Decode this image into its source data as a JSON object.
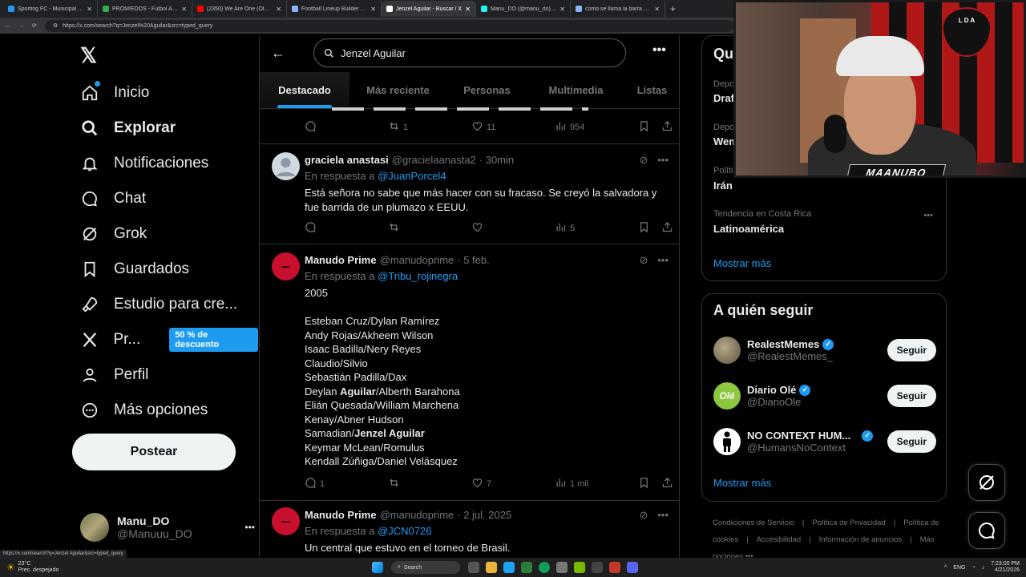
{
  "browser": {
    "tabs": [
      {
        "title": "Sporting FC - Municipal Liberia",
        "color": "#1d9bf0"
      },
      {
        "title": "PROMIEDOS - Futbol Argentino",
        "color": "#34a853"
      },
      {
        "title": "(2350) We Are One (Ole Ola) [",
        "color": "#ff0000"
      },
      {
        "title": "Football Lineup Builder - Creat",
        "color": "#8ab4f8"
      },
      {
        "title": "Jenzel Aguilar - Buscar / X",
        "color": "#ffffff",
        "active": true
      },
      {
        "title": "Manu_DO (@manu_do) | TikT",
        "color": "#25f4ee"
      },
      {
        "title": "como se llama la barra del Mu",
        "color": "#8ab4f8"
      }
    ],
    "url": "https://x.com/search?q=Jenzel%20Aguilar&src=typed_query",
    "status_url": "https://x.com/search?q=Jenzel Aguilar&src=typed_query"
  },
  "sidebar": {
    "logo": "𝕏",
    "items": [
      {
        "label": "Inicio",
        "icon": "home-icon"
      },
      {
        "label": "Explorar",
        "icon": "search-icon",
        "active": true
      },
      {
        "label": "Notificaciones",
        "icon": "bell-icon"
      },
      {
        "label": "Chat",
        "icon": "chat-icon"
      },
      {
        "label": "Grok",
        "icon": "grok-icon"
      },
      {
        "label": "Guardados",
        "icon": "bookmark-icon"
      },
      {
        "label": "Estudio para cre...",
        "icon": "rocket-icon"
      },
      {
        "label": "Pr...",
        "icon": "x-icon"
      },
      {
        "label": "Perfil",
        "icon": "person-icon"
      },
      {
        "label": "Más opciones",
        "icon": "more-circle-icon"
      }
    ],
    "promo_badge": "50 % de descuento",
    "post_button": "Postear",
    "account": {
      "name": "Manu_DO",
      "handle": "@Manuuu_DO",
      "more": "•••"
    }
  },
  "search": {
    "query": "Jenzel Aguilar",
    "tabs": [
      "Destacado",
      "Más reciente",
      "Personas",
      "Multimedia",
      "Listas"
    ],
    "active_tab": "Destacado"
  },
  "tweets": [
    {
      "partial": true,
      "actions": {
        "replies": "",
        "retweets": "1",
        "likes": "11",
        "views": "954"
      }
    },
    {
      "name": "graciela anastasi",
      "handle": "@gracielaanasta2",
      "time": "· 30min",
      "reply_prefix": "En respuesta a",
      "reply_to": "@JuanPorcel4",
      "text": "Está señora no sabe que más hacer con su fracaso. Se creyó la salvadora y fue barrida de un plumazo x EEUU.",
      "actions": {
        "replies": "",
        "retweets": "",
        "likes": "",
        "views": "5"
      }
    },
    {
      "name": "Manudo Prime",
      "handle": "@manudoprime",
      "time": "· 5 feb.",
      "reply_prefix": "En respuesta a",
      "reply_to": "@Tribu_rojinegra",
      "text": "2005\n\nEsteban Cruz/Dylan Ramírez\nAndy Rojas/Akheem Wilson\nIsaac Badilla/Nery Reyes\nClaudio/Silvio\nSebastián Padilla/Dax\nDeylan Aguilar/Alberth Barahona\nElián Quesada/William Marchena\nKenay/Abner Hudson\nSamadian/Jenzel Aguilar\nKeymar McLean/Romulus\nKendall Zúñiga/Daniel Velásquez",
      "actions": {
        "replies": "1",
        "retweets": "",
        "likes": "7",
        "views": "1 mil"
      }
    },
    {
      "name": "Manudo Prime",
      "handle": "@manudoprime",
      "time": "· 2 jul. 2025",
      "reply_prefix": "En respuesta a",
      "reply_to": "@JCN0726",
      "text": "Un central que estuvo en el torneo de Brasil."
    }
  ],
  "trends": {
    "title": "Qu",
    "items": [
      {
        "context": "Depo",
        "name": "Draf"
      },
      {
        "context": "Depo",
        "name": "Wem"
      },
      {
        "context": "Políti",
        "name": "Irán"
      },
      {
        "context": "Tendencia en Costa Rica",
        "name": "Latinoamérica"
      }
    ],
    "show_more": "Mostrar más"
  },
  "who_to_follow": {
    "title": "A quién seguir",
    "items": [
      {
        "name": "RealestMemes",
        "handle": "@RealestMemes_",
        "button": "Seguir"
      },
      {
        "name": "Diario Olé",
        "handle": "@DiarioOle",
        "button": "Seguir",
        "avatar_text": "Olé"
      },
      {
        "name": "NO CONTEXT HUM...",
        "handle": "@HumansNoContext",
        "button": "Seguir"
      }
    ],
    "show_more": "Mostrar más"
  },
  "footer": {
    "links": [
      "Condiciones de Servicio",
      "|",
      "Política de Privacidad",
      "|",
      "Política de cookies",
      "|",
      "Accesibilidad",
      "|",
      "Información de anuncios",
      "|",
      "Más opciones •••"
    ]
  },
  "webcam": {
    "overlay_name": "MAANUBO",
    "crest_text": "L D A"
  },
  "taskbar": {
    "weather_temp": "23°C",
    "weather_desc": "Prec. despejado",
    "search_label": "Search",
    "lang": "ENG",
    "time": "7:23:00 PM",
    "date": "4/21/2026"
  },
  "colors": {
    "accent": "#1d9bf0",
    "background": "#000000",
    "border": "#2f3336",
    "muted": "#71767b"
  }
}
